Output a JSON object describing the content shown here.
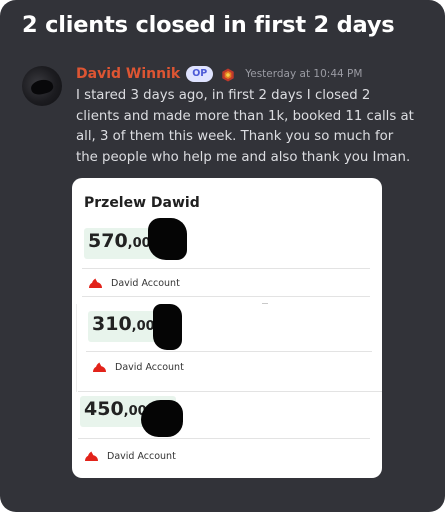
{
  "post": {
    "title": "2 clients closed in first 2 days"
  },
  "message": {
    "author": "David Winnik",
    "badge": "OP",
    "role_icon": "hexagon-role-icon",
    "timestamp": "Yesterday at 10:44 PM",
    "body": "I stared 3 days ago, in first 2 days I closed 2 clients and made more than 1k, booked 11 calls at all, 3 of them this week. Thank you so much for the people who help me and also thank you Iman."
  },
  "receipt": {
    "title": "Przelew Dawid",
    "entries": [
      {
        "integer": "570",
        "decimal": ",00",
        "account": "David Account"
      },
      {
        "integer": "310",
        "decimal": ",00",
        "account": "David Account"
      },
      {
        "integer": "450",
        "decimal": ",00",
        "account": "David Account"
      }
    ]
  },
  "colors": {
    "background": "#323339",
    "author": "#dd5533",
    "op_badge": "#dfe3ff",
    "amount_highlight": "#e8f4ec",
    "bank_logo": "#e2231a"
  }
}
